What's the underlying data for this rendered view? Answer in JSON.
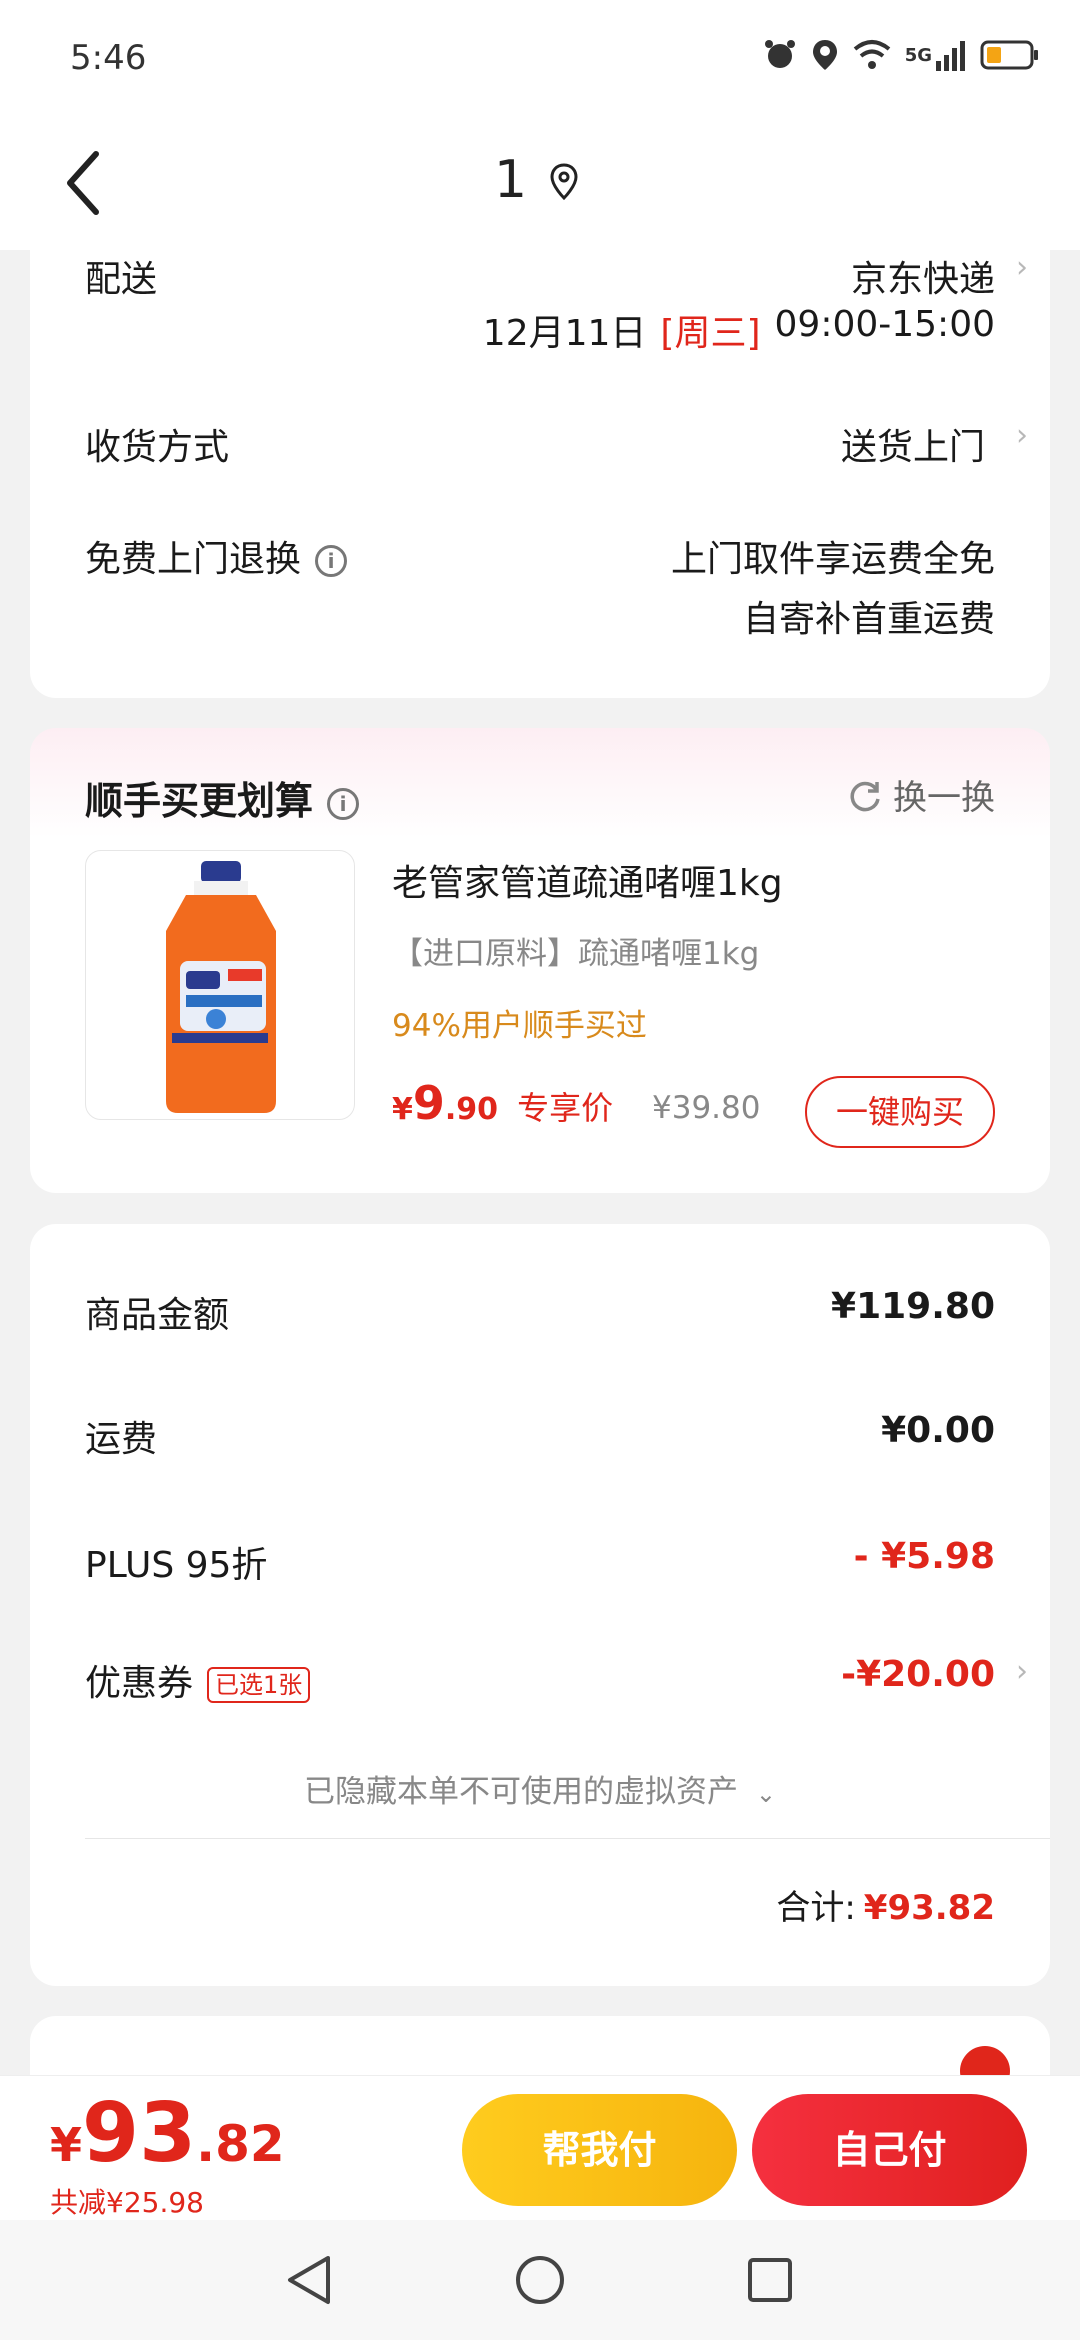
{
  "status_bar": {
    "time": "5:46",
    "network": "5G"
  },
  "nav": {
    "title": "1"
  },
  "delivery": {
    "label": "配送",
    "carrier": "京东快递",
    "date": "12月11日",
    "weekday": "[周三]",
    "time_window": "09:00-15:00",
    "method_label": "收货方式",
    "method_value": "送货上门",
    "return_label": "免费上门退换",
    "return_line1": "上门取件享运费全免",
    "return_line2": "自寄补首重运费"
  },
  "addon": {
    "title": "顺手买更划算",
    "refresh_label": "换一换",
    "product_name": "老管家管道疏通啫喱1kg",
    "product_sub": "【进口原料】疏通啫喱1kg",
    "social_proof": "94%用户顺手买过",
    "price_symbol": "¥",
    "price_int": "9",
    "price_dec": ".90",
    "price_tag": "专享价",
    "original_price": "¥39.80",
    "buy_label": "一键购买"
  },
  "summary": {
    "goods_label": "商品金额",
    "goods_value": "¥119.80",
    "shipping_label": "运费",
    "shipping_value": "¥0.00",
    "plus_label": "PLUS 95折",
    "plus_value": "- ¥5.98",
    "coupon_label": "优惠券",
    "coupon_tag": "已选1张",
    "coupon_value": "-¥20.00",
    "hidden_note": "已隐藏本单不可使用的虚拟资产",
    "total_label": "合计:",
    "total_value": "¥93.82"
  },
  "bottom": {
    "yen": "¥",
    "price_int": "93",
    "price_dec": ".82",
    "saved": "共减¥25.98",
    "help_pay": "帮我付",
    "self_pay": "自己付"
  },
  "colors": {
    "accent_red": "#e0261b",
    "orange_text": "#d88a1c",
    "yellow_btn": "#ffcc1e"
  }
}
